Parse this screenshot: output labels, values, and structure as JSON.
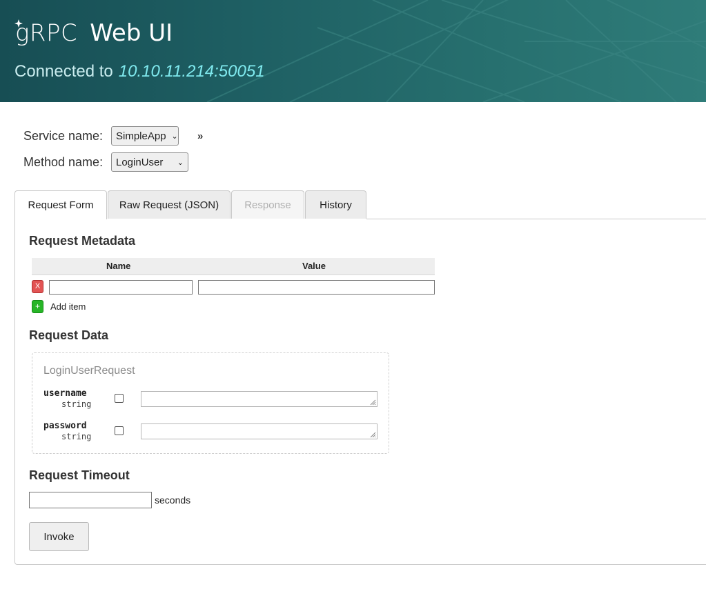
{
  "header": {
    "logo_text": "gRPC",
    "title": "Web UI",
    "connected_label": "Connected to",
    "address": "10.10.11.214:50051"
  },
  "form": {
    "service_label": "Service name:",
    "service_value": "SimpleApp",
    "method_label": "Method name:",
    "method_value": "LoginUser",
    "expand_label": "»"
  },
  "tabs": [
    {
      "label": "Request Form",
      "state": "active"
    },
    {
      "label": "Raw Request (JSON)",
      "state": "normal"
    },
    {
      "label": "Response",
      "state": "disabled"
    },
    {
      "label": "History",
      "state": "normal"
    }
  ],
  "metadata": {
    "heading": "Request Metadata",
    "col_name": "Name",
    "col_value": "Value",
    "remove_label": "X",
    "add_icon": "+",
    "add_label": "Add item",
    "name_value": "",
    "value_value": ""
  },
  "request_data": {
    "heading": "Request Data",
    "message_name": "LoginUserRequest",
    "fields": [
      {
        "name": "username",
        "type": "string",
        "value": ""
      },
      {
        "name": "password",
        "type": "string",
        "value": ""
      }
    ]
  },
  "timeout": {
    "heading": "Request Timeout",
    "value": "",
    "unit": "seconds"
  },
  "invoke_label": "Invoke",
  "colors": {
    "header_bg": "#1e5f63",
    "address": "#7fe9ee",
    "remove_button": "#e25454",
    "add_button": "#27b527"
  }
}
